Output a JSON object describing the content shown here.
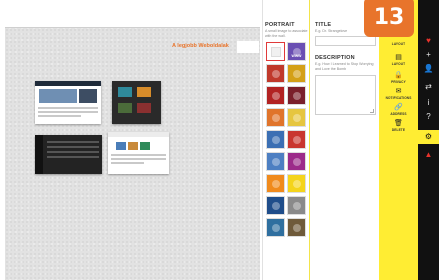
{
  "wall": {
    "title": "A legjobb Weboldalak"
  },
  "portrait": {
    "title": "PORTRAIT",
    "subtitle": "A small image to associate with the wall.",
    "thumbs": [
      {
        "color": "#ffffff",
        "selected": true
      },
      {
        "color": "#6a4fb3",
        "label": "WWW"
      },
      {
        "color": "#c0392b"
      },
      {
        "color": "#d4a017"
      },
      {
        "color": "#b22222"
      },
      {
        "color": "#7a1f2b"
      },
      {
        "color": "#e0742b"
      },
      {
        "color": "#e6c640"
      },
      {
        "color": "#3b6fb3"
      },
      {
        "color": "#c9362f"
      },
      {
        "color": "#4d7fc2"
      },
      {
        "color": "#9c2b8a"
      },
      {
        "color": "#f08a1c"
      },
      {
        "color": "#f4d41c"
      },
      {
        "color": "#1f4d8a"
      },
      {
        "color": "#8a8a8a"
      },
      {
        "color": "#2f6f9f"
      },
      {
        "color": "#6f5a3a"
      }
    ]
  },
  "form": {
    "title_label": "TITLE",
    "title_hint": "E.g. Dr. Strangelove",
    "description_label": "DESCRIPTION",
    "description_hint": "E.g. How I Learned to Stop Worrying and Love the Bomb"
  },
  "tools": [
    {
      "icon": "",
      "label": "LAYOUT"
    },
    {
      "icon": "",
      "label": "PRIVACY"
    },
    {
      "icon": "",
      "label": "NOTIFICATIONS"
    },
    {
      "icon": "",
      "label": "ADDRESS"
    },
    {
      "icon": "",
      "label": "DELETE"
    }
  ],
  "dark_icons": [
    {
      "name": "padlet-logo-icon",
      "glyph": "♥"
    },
    {
      "name": "add-icon",
      "glyph": "+"
    },
    {
      "name": "profile-icon",
      "glyph": "👤"
    },
    {
      "name": "share-icon",
      "glyph": "⇄"
    },
    {
      "name": "info-icon",
      "glyph": "i"
    },
    {
      "name": "help-icon",
      "glyph": "?"
    },
    {
      "name": "settings-icon",
      "glyph": "⚙"
    },
    {
      "name": "alert-icon",
      "glyph": "▲"
    }
  ],
  "step_badge": "13"
}
